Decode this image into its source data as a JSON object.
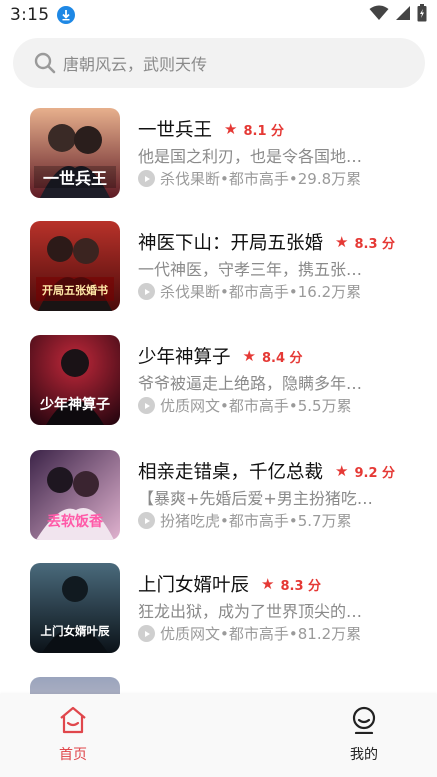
{
  "status_bar": {
    "time": "3:15"
  },
  "search": {
    "placeholder": "唐朝风云，武则天传"
  },
  "books": [
    {
      "title": "一世兵王",
      "score": "8.1 分",
      "desc": "他是国之利刃，也是令各国地…",
      "category": "杀伐果断",
      "genre": "都市高手",
      "reads": "29.8万累",
      "cover_text": "一世兵王",
      "cover_colors": [
        "#6b1f2a",
        "#e3a07a"
      ]
    },
    {
      "title": "神医下山：开局五张婚",
      "score": "8.3 分",
      "desc": "一代神医，守孝三年，携五张…",
      "category": "杀伐果断",
      "genre": "都市高手",
      "reads": "16.2万累",
      "cover_text": "开局五张婚书",
      "cover_colors": [
        "#5c0d0d",
        "#c0392b"
      ]
    },
    {
      "title": "少年神算子",
      "score": "8.4 分",
      "desc": "爷爷被逼走上绝路，隐瞒多年…",
      "category": "优质网文",
      "genre": "都市高手",
      "reads": "5.5万累",
      "cover_text": "少年神算子",
      "cover_colors": [
        "#3b0a14",
        "#a61e2e"
      ]
    },
    {
      "title": "相亲走错桌，千亿总裁",
      "score": "9.2 分",
      "desc": "【暴爽+先婚后爱+男主扮猪吃…",
      "category": "扮猪吃虎",
      "genre": "都市高手",
      "reads": "5.7万累",
      "cover_text": "丢软饭香",
      "cover_colors": [
        "#4a2a55",
        "#d8a6c6"
      ]
    },
    {
      "title": "上门女婿叶辰",
      "score": "8.3 分",
      "desc": "狂龙出狱，成为了世界顶尖的…",
      "category": "优质网文",
      "genre": "都市高手",
      "reads": "81.2万累",
      "cover_text": "上门女婿叶辰",
      "cover_colors": [
        "#0f1a22",
        "#3a5566"
      ]
    }
  ],
  "nav": {
    "home_label": "首页",
    "mine_label": "我的"
  },
  "colors": {
    "accent": "#e53935",
    "nav_active": "#e0474c"
  }
}
